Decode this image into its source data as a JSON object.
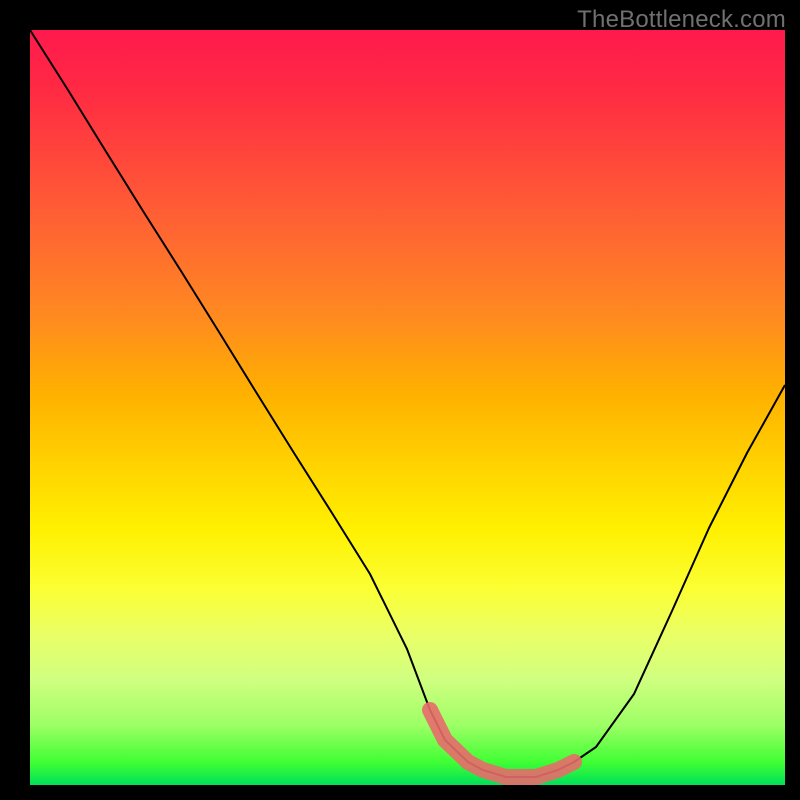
{
  "watermark": "TheBottleneck.com",
  "chart_data": {
    "type": "line",
    "title": "",
    "xlabel": "",
    "ylabel": "",
    "xlim": [
      0,
      100
    ],
    "ylim": [
      0,
      100
    ],
    "grid": false,
    "legend": false,
    "background": "rainbow-vertical",
    "series": [
      {
        "name": "bottleneck-curve",
        "x": [
          0,
          5,
          10,
          15,
          20,
          25,
          30,
          35,
          40,
          45,
          50,
          53,
          55,
          58,
          60,
          63,
          65,
          67,
          70,
          72,
          75,
          80,
          85,
          90,
          95,
          100
        ],
        "y": [
          100,
          92,
          84,
          76,
          68,
          60,
          52,
          44,
          36,
          28,
          18,
          10,
          6,
          3,
          2,
          1,
          1,
          1,
          2,
          3,
          5,
          12,
          23,
          34,
          44,
          53
        ],
        "stroke": "#000000",
        "stroke_width": 2
      }
    ],
    "highlight_segment": {
      "description": "flat minimum region marked in salmon",
      "x": [
        53,
        72
      ],
      "y_approx": 2,
      "stroke": "#e86b6b",
      "stroke_width": 16
    }
  }
}
